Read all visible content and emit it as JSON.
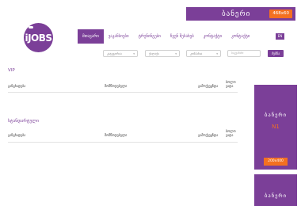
{
  "top_banner": {
    "text": "ბანერი",
    "size": "468x60"
  },
  "logo": {
    "text": "iJOBS"
  },
  "nav": {
    "items": [
      {
        "label": "მთავარი",
        "active": true
      },
      {
        "label": "ვაკანსიები"
      },
      {
        "label": "ტრენინგები"
      },
      {
        "label": "ჩვენ შესახებ"
      },
      {
        "label": "კონტაქტი"
      },
      {
        "label": "კონტაქტი"
      }
    ],
    "lang": "EN"
  },
  "filters": {
    "select1": "კატეგორია",
    "select2": "ქალაქი",
    "select3": "კომპანია",
    "input_placeholder": "საკვანძო",
    "search_label": "ძებნა"
  },
  "sections": [
    {
      "title": "VIP",
      "columns": [
        "განცხადება",
        "მომწოდებელი",
        "გამოქვეყნდა",
        "ბოლო ვადა"
      ]
    },
    {
      "title": "სტანდარტული",
      "columns": [
        "განცხადება",
        "მომწოდებელი",
        "გამოქვეყნდა",
        "ბოლო ვადა"
      ]
    }
  ],
  "side_banners": [
    {
      "text": "ბანერი",
      "number": "N1",
      "size": "200x400"
    },
    {
      "text": "ბანერი"
    }
  ],
  "colors": {
    "brand": "#7b3f98",
    "accent": "#f37021"
  }
}
